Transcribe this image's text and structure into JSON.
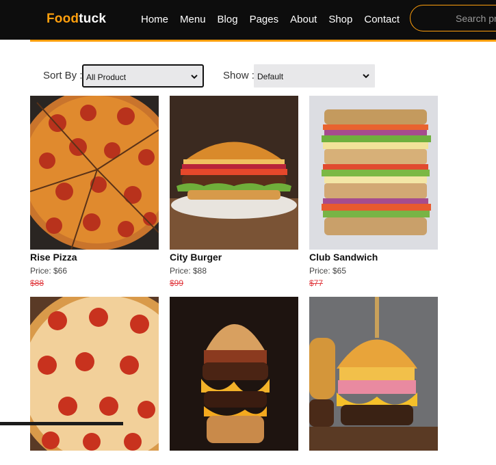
{
  "brand": {
    "part1": "Food",
    "part2": "tuck"
  },
  "nav": [
    {
      "label": "Home"
    },
    {
      "label": "Menu"
    },
    {
      "label": "Blog"
    },
    {
      "label": "Pages"
    },
    {
      "label": "About"
    },
    {
      "label": "Shop"
    },
    {
      "label": "Contact"
    }
  ],
  "search": {
    "placeholder": "Search pr"
  },
  "filters": {
    "sort_label": "Sort By :",
    "sort_value": "All Product",
    "show_label": "Show :",
    "show_value": "Default"
  },
  "products": [
    {
      "name": "Rise Pizza",
      "price": "Price: $66",
      "old_price": "$88",
      "image": "pepperoni-pizza-sliced"
    },
    {
      "name": "City Burger",
      "price": "Price: $88",
      "old_price": "$99",
      "image": "burger-on-plate"
    },
    {
      "name": "Club Sandwich",
      "price": "Price: $65",
      "old_price": "$77",
      "image": "stacked-club-sandwich"
    },
    {
      "name": "",
      "price": "",
      "old_price": "",
      "image": "pepperoni-pizza"
    },
    {
      "name": "",
      "price": "",
      "old_price": "",
      "image": "bacon-cheese-burger"
    },
    {
      "name": "",
      "price": "",
      "old_price": "",
      "image": "skewered-cheese-burgers"
    }
  ],
  "colors": {
    "accent": "#ff9f0d",
    "navbar_bg": "#0d0d0d",
    "old_price": "#e0393e"
  }
}
